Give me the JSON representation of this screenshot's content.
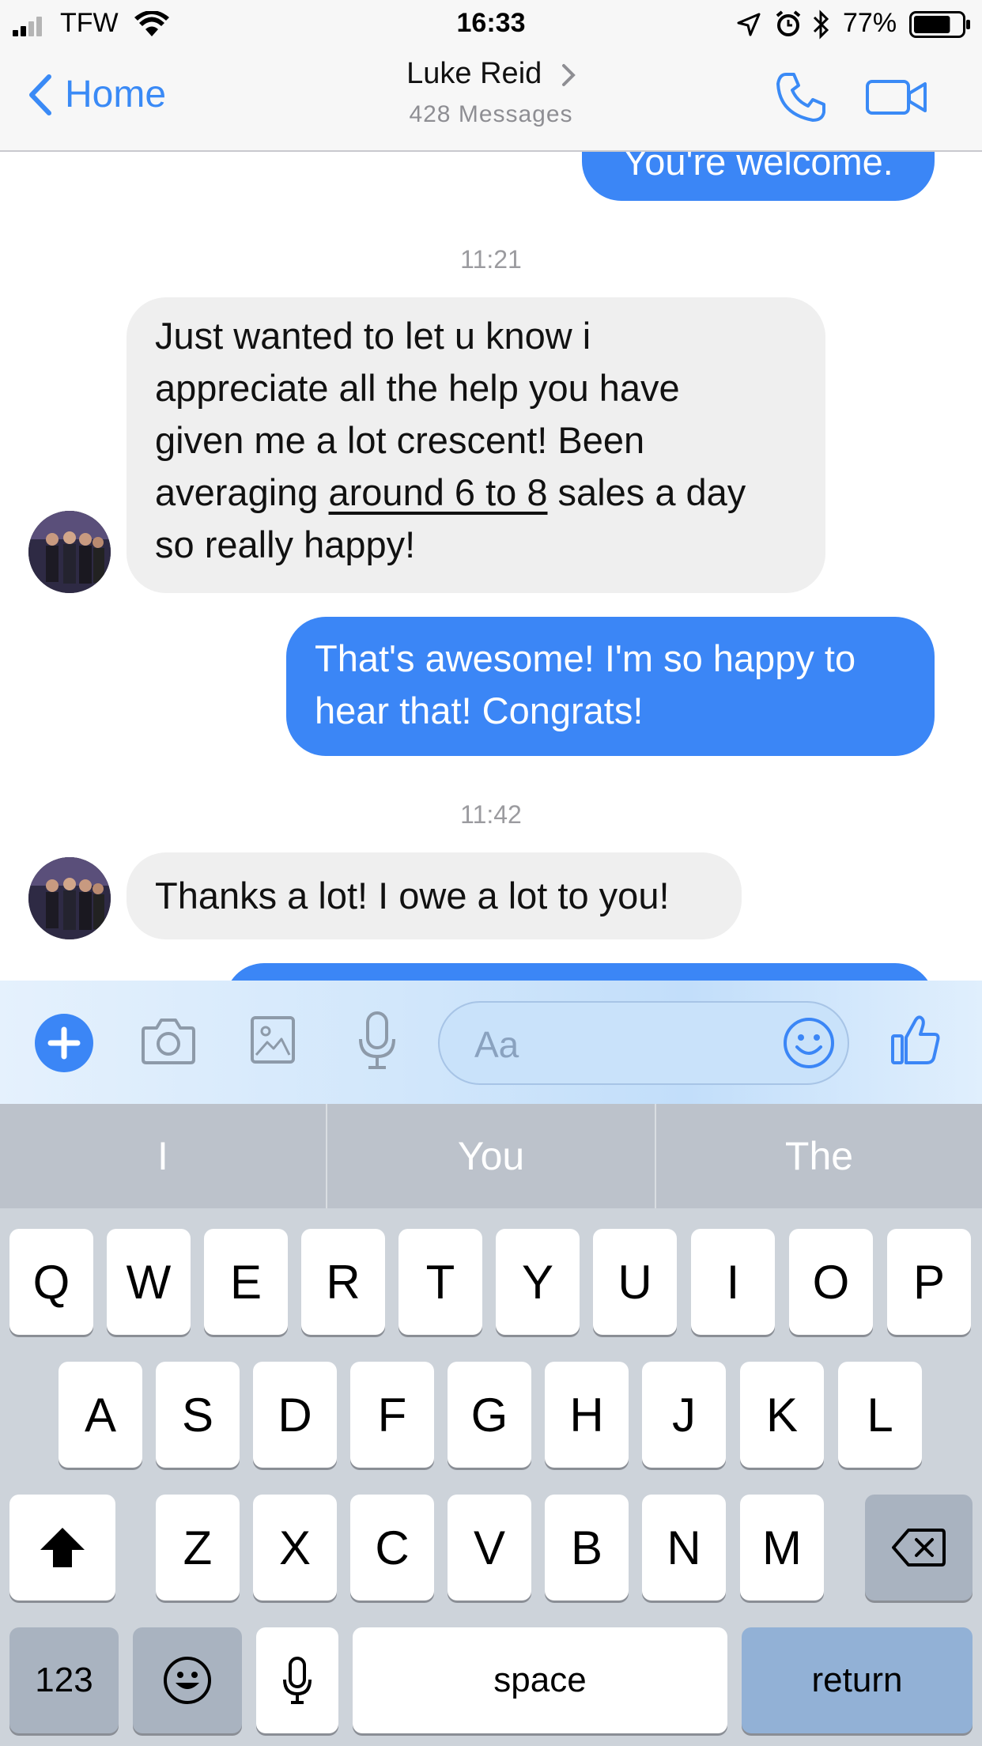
{
  "status_bar": {
    "carrier": "TFW",
    "time": "16:33",
    "battery_percent": "77%",
    "battery_level": 0.77
  },
  "nav_bar": {
    "back_label": "Home",
    "contact_name": "Luke Reid",
    "message_count": "428 Messages"
  },
  "messages": [
    {
      "type": "outgoing",
      "text": "You're welcome."
    },
    {
      "type": "timestamp",
      "text": "11:21"
    },
    {
      "type": "incoming",
      "lines": [
        "Just wanted to let u know i",
        "appreciate all the help you have",
        "given me a lot crescent! Been"
      ],
      "line4_before": "averaging ",
      "line4_link": "around 6 to 8",
      "line4_after": " sales a day",
      "line5": "so really happy!"
    },
    {
      "type": "outgoing",
      "lines": [
        "That's awesome! I'm so happy to",
        "hear that! Congrats!"
      ]
    },
    {
      "type": "timestamp",
      "text": "11:42"
    },
    {
      "type": "incoming",
      "text": "Thanks a lot! I owe a lot to you!"
    }
  ],
  "composer": {
    "placeholder": "Aa",
    "icons": [
      "plus-icon",
      "camera-icon",
      "image-icon",
      "microphone-icon",
      "emoji-icon",
      "thumbs-up-icon"
    ]
  },
  "keyboard": {
    "suggestions": [
      "I",
      "You",
      "The"
    ],
    "row1": [
      "Q",
      "W",
      "E",
      "R",
      "T",
      "Y",
      "U",
      "I",
      "O",
      "P"
    ],
    "row2": [
      "A",
      "S",
      "D",
      "F",
      "G",
      "H",
      "J",
      "K",
      "L"
    ],
    "row3": [
      "Z",
      "X",
      "C",
      "V",
      "B",
      "N",
      "M"
    ],
    "numbers_key": "123",
    "space_key": "space",
    "return_key": "return"
  },
  "colors": {
    "accent_blue": "#3b86f6",
    "incoming_bubble": "#efefef",
    "keyboard_bg": "#cdd3da"
  }
}
